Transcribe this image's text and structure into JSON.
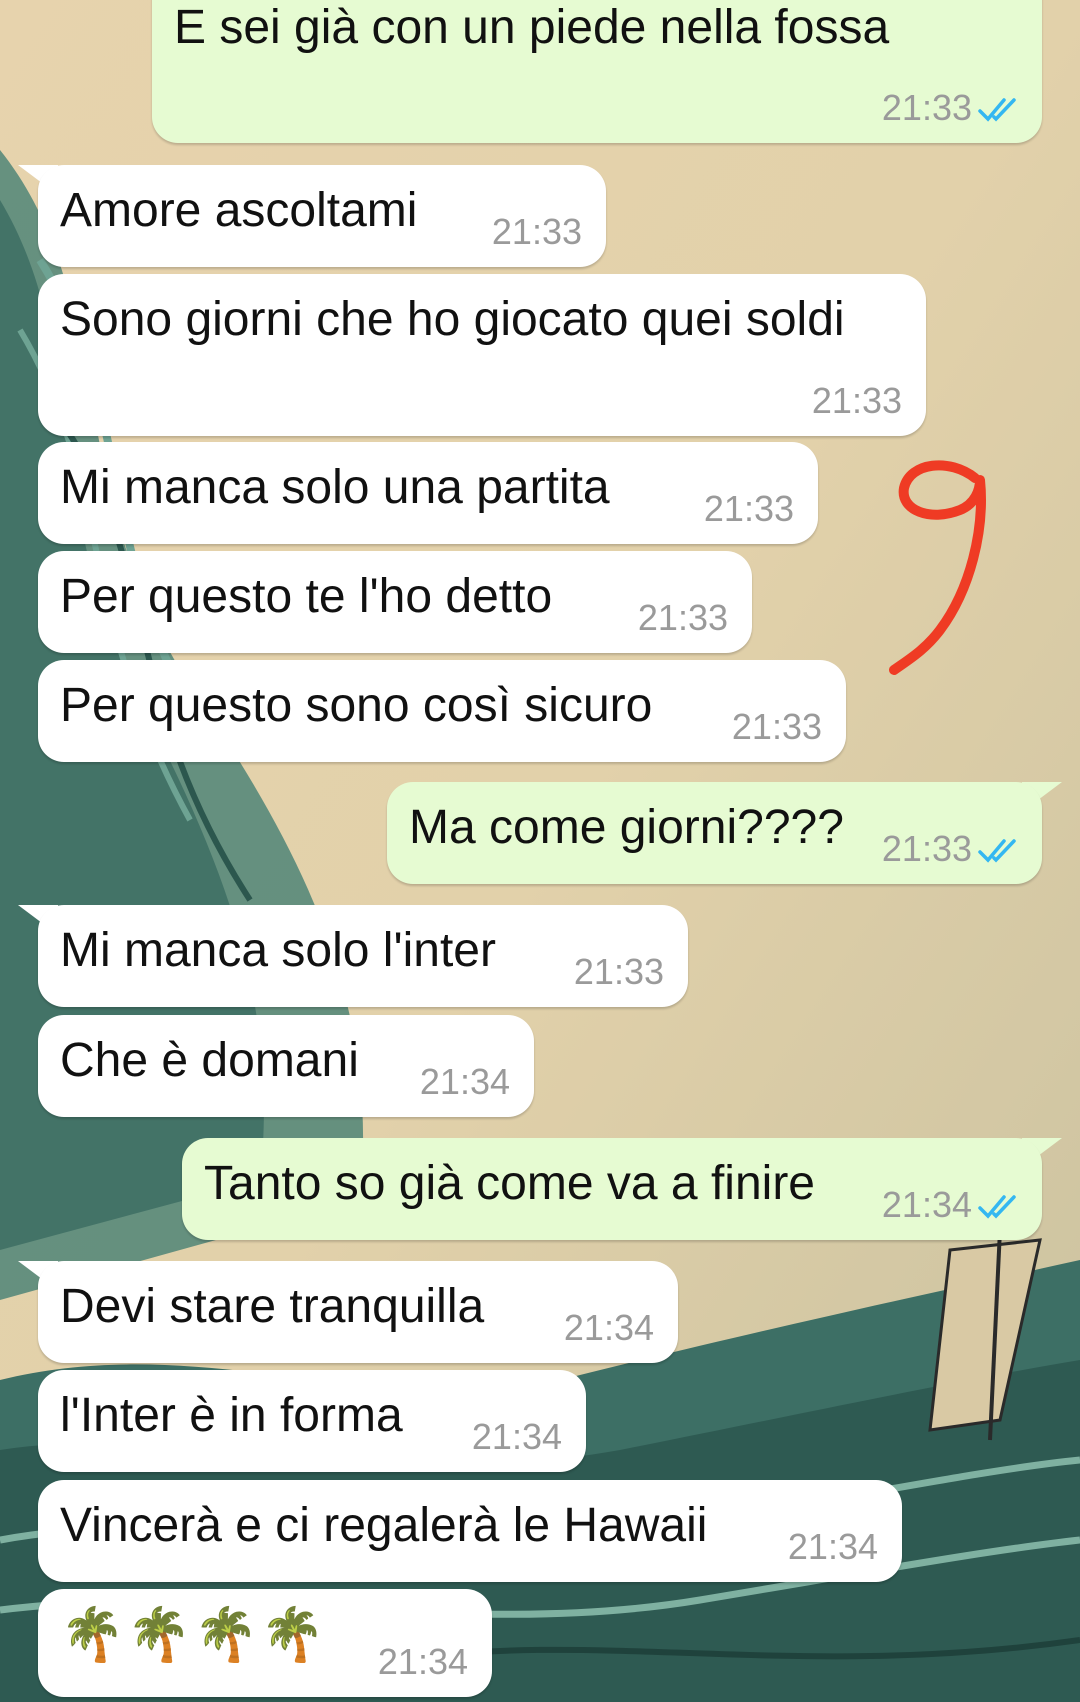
{
  "colors": {
    "incoming_bubble": "#ffffff",
    "outgoing_bubble": "#e6fbd2",
    "read_ticks": "#34b7f1",
    "timestamp": "#9a9a9a",
    "doodle": "#ef3b24"
  },
  "doodle": {
    "text": "9"
  },
  "messages": [
    {
      "id": "m1",
      "direction": "out",
      "text": "E sei già con un piede nella fossa",
      "time": "21:33",
      "status": "read"
    },
    {
      "id": "m2",
      "direction": "in",
      "text": "Amore ascoltami",
      "time": "21:33"
    },
    {
      "id": "m3",
      "direction": "in",
      "text": "Sono giorni che ho giocato quei soldi",
      "time": "21:33"
    },
    {
      "id": "m4",
      "direction": "in",
      "text": "Mi manca solo una partita",
      "time": "21:33"
    },
    {
      "id": "m5",
      "direction": "in",
      "text": "Per questo te l'ho detto",
      "time": "21:33"
    },
    {
      "id": "m6",
      "direction": "in",
      "text": "Per questo sono così sicuro",
      "time": "21:33"
    },
    {
      "id": "m7",
      "direction": "out",
      "text": "Ma come giorni????",
      "time": "21:33",
      "status": "read"
    },
    {
      "id": "m8",
      "direction": "in",
      "text": "Mi manca solo l'inter",
      "time": "21:33"
    },
    {
      "id": "m9",
      "direction": "in",
      "text": "Che è domani",
      "time": "21:34"
    },
    {
      "id": "m10",
      "direction": "out",
      "text": "Tanto so già come va a finire",
      "time": "21:34",
      "status": "read"
    },
    {
      "id": "m11",
      "direction": "in",
      "text": "Devi stare tranquilla",
      "time": "21:34"
    },
    {
      "id": "m12",
      "direction": "in",
      "text": "l'Inter è in forma",
      "time": "21:34"
    },
    {
      "id": "m13",
      "direction": "in",
      "text": "Vincerà e ci regalerà le Hawaii",
      "time": "21:34"
    },
    {
      "id": "m14",
      "direction": "in",
      "text": "🌴🌴🌴🌴",
      "time": "21:34"
    }
  ]
}
